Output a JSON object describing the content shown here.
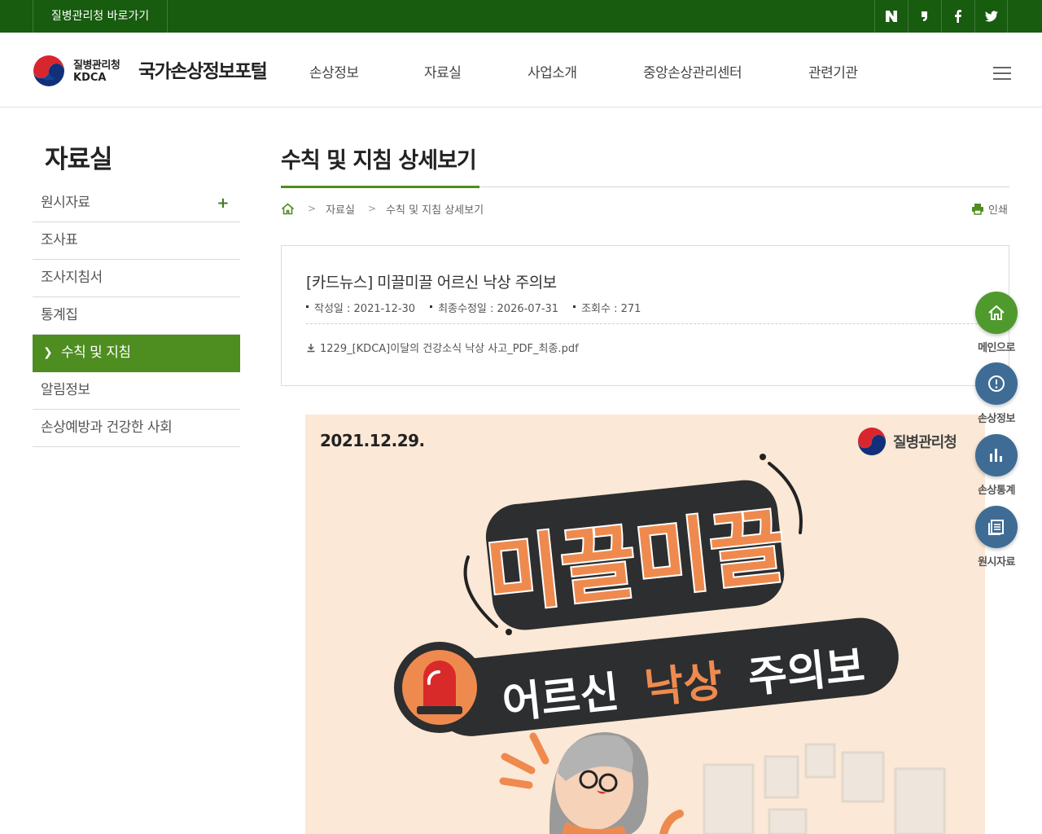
{
  "topbar": {
    "shortcut_label": "질병관리청 바로가기",
    "sns": [
      {
        "name": "naver-blog-icon"
      },
      {
        "name": "naver-post-icon"
      },
      {
        "name": "facebook-icon"
      },
      {
        "name": "twitter-icon"
      }
    ]
  },
  "header": {
    "agency_ko": "질병관리청",
    "agency_en": "KDCA",
    "portal_name": "국가손상정보포털",
    "nav": [
      "손상정보",
      "자료실",
      "사업소개",
      "중앙손상관리센터",
      "관련기관"
    ]
  },
  "sidebar": {
    "title": "자료실",
    "items": [
      {
        "label": "원시자료",
        "expand": "+"
      },
      {
        "label": "조사표"
      },
      {
        "label": "조사지침서"
      },
      {
        "label": "통계집"
      },
      {
        "label": "수칙 및 지침",
        "active": true
      },
      {
        "label": "알림정보"
      },
      {
        "label": "손상예방과 건강한 사회"
      }
    ]
  },
  "content": {
    "page_title": "수칙 및 지침 상세보기",
    "breadcrumb": [
      "자료실",
      "수칙 및 지침 상세보기"
    ],
    "print_label": "인쇄",
    "article": {
      "title": "[카드뉴스] 미끌미끌 어르신 낙상 주의보",
      "created": "작성일 : 2021-12-30",
      "modified": "최종수정일 : 2026-07-31",
      "views": "조회수 : 271",
      "attachment": "1229_[KDCA]이달의 건강소식 낙상 사고_PDF_최종.pdf"
    },
    "card": {
      "date": "2021.12.29.",
      "logo_text": "질병관리청",
      "headline": "미끌미끌",
      "subtitle_1": "어르신",
      "subtitle_2": "낙상",
      "subtitle_3": "주의보"
    }
  },
  "quick_menu": [
    {
      "label": "메인으로",
      "color": "#4e9a2c"
    },
    {
      "label": "손상정보",
      "color": "#3e6c95"
    },
    {
      "label": "손상통계",
      "color": "#3e6c95"
    },
    {
      "label": "원시자료",
      "color": "#3e6c95"
    }
  ],
  "colors": {
    "topbar": "#185c0f",
    "accent_green": "#4e8d20",
    "card_bg": "#fbe8d6",
    "card_orange": "#ef8a4f",
    "card_dark": "#2c2e30"
  }
}
